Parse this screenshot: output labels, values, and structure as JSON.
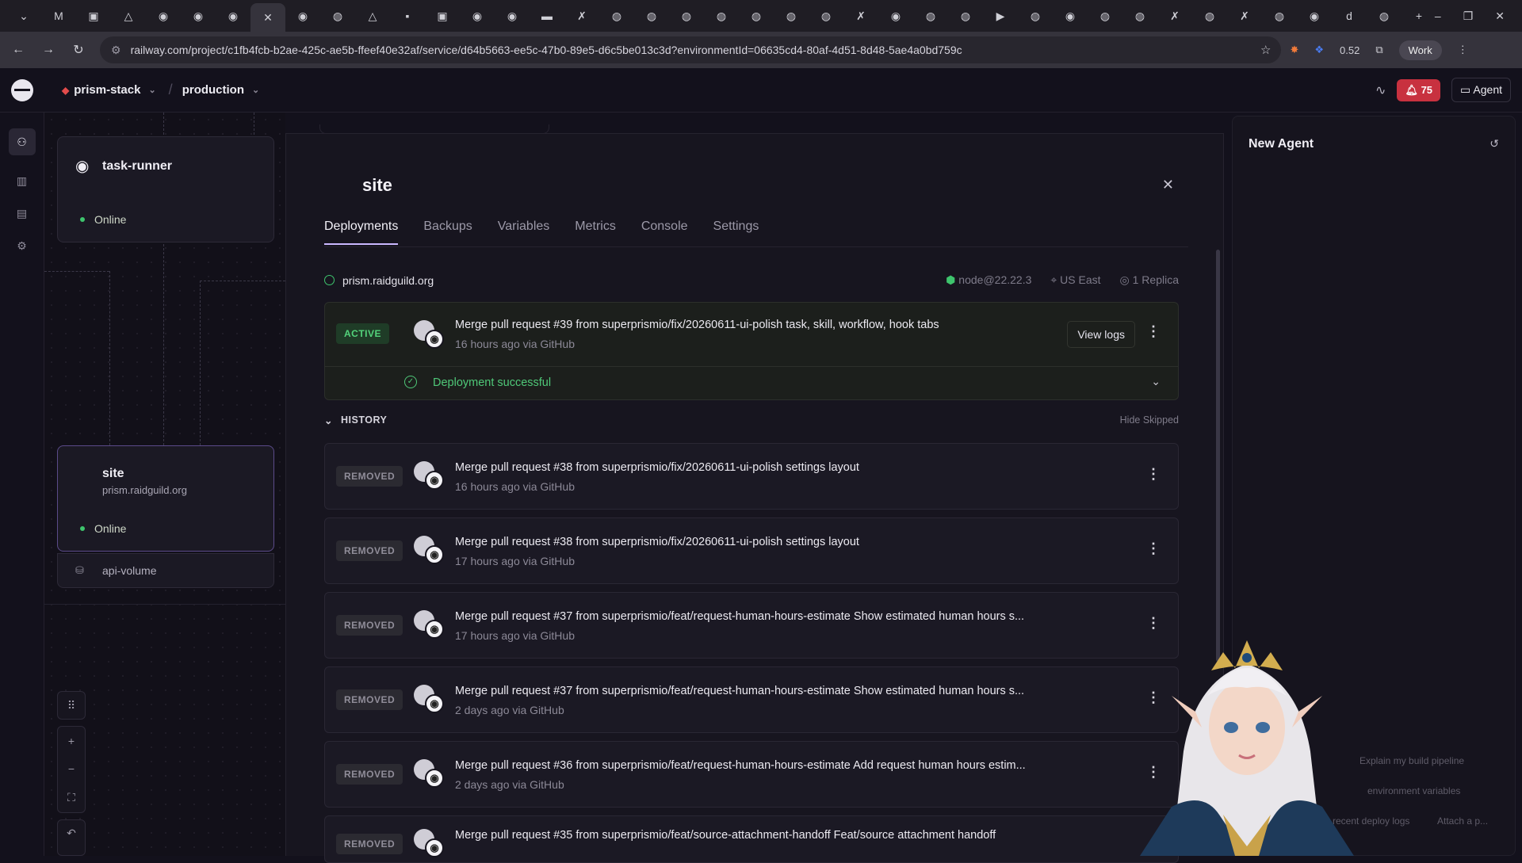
{
  "browser": {
    "url": "railway.com/project/c1fb4fcb-b2ae-425c-ae5b-ffeef40e32af/service/d64b5663-ee5c-47b0-89e5-d6c5be013c3d?environmentId=06635cd4-80af-4d51-8d48-5ae4a0bd759c",
    "ext_badge": "0.52",
    "profile": "Work"
  },
  "header": {
    "project": "prism-stack",
    "environment": "production",
    "notifications": "75",
    "agent_label": "Agent"
  },
  "canvas": {
    "task_runner": {
      "name": "task-runner",
      "status": "Online"
    },
    "site": {
      "name": "site",
      "domain": "prism.raidguild.org",
      "status": "Online"
    },
    "volume": {
      "name": "api-volume"
    }
  },
  "panel": {
    "title": "site",
    "tabs": [
      "Deployments",
      "Backups",
      "Variables",
      "Metrics",
      "Console",
      "Settings"
    ],
    "domain": "prism.raidguild.org",
    "runtime": "node@22.22.3",
    "region": "US East",
    "replicas": "1 Replica",
    "active": {
      "badge": "ACTIVE",
      "message": "Merge pull request #39 from superprismio/fix/20260611-ui-polish task, skill, workflow, hook tabs",
      "time": "16 hours ago via GitHub",
      "view_logs": "View logs",
      "status": "Deployment successful"
    },
    "history_label": "HISTORY",
    "hide_skipped": "Hide Skipped",
    "history": [
      {
        "badge": "REMOVED",
        "message": "Merge pull request #38 from superprismio/fix/20260611-ui-polish settings layout",
        "time": "16 hours ago via GitHub"
      },
      {
        "badge": "REMOVED",
        "message": "Merge pull request #38 from superprismio/fix/20260611-ui-polish settings layout",
        "time": "17 hours ago via GitHub"
      },
      {
        "badge": "REMOVED",
        "message": "Merge pull request #37 from superprismio/feat/request-human-hours-estimate Show estimated human hours s...",
        "time": "17 hours ago via GitHub"
      },
      {
        "badge": "REMOVED",
        "message": "Merge pull request #37 from superprismio/feat/request-human-hours-estimate Show estimated human hours s...",
        "time": "2 days ago via GitHub"
      },
      {
        "badge": "REMOVED",
        "message": "Merge pull request #36 from superprismio/feat/request-human-hours-estimate Add request human hours estim...",
        "time": "2 days ago via GitHub"
      },
      {
        "badge": "REMOVED",
        "message": "Merge pull request #35 from superprismio/feat/source-attachment-handoff Feat/source attachment handoff",
        "time": ""
      }
    ]
  },
  "agent_panel": {
    "title": "New Agent",
    "suggestions": [
      "Explain my build pipeline",
      "environment variables",
      "recent deploy logs",
      "Attach a p..."
    ]
  },
  "colors": {
    "accent": "#cbb8ff",
    "success": "#4fc878",
    "danger": "#c8313f"
  }
}
